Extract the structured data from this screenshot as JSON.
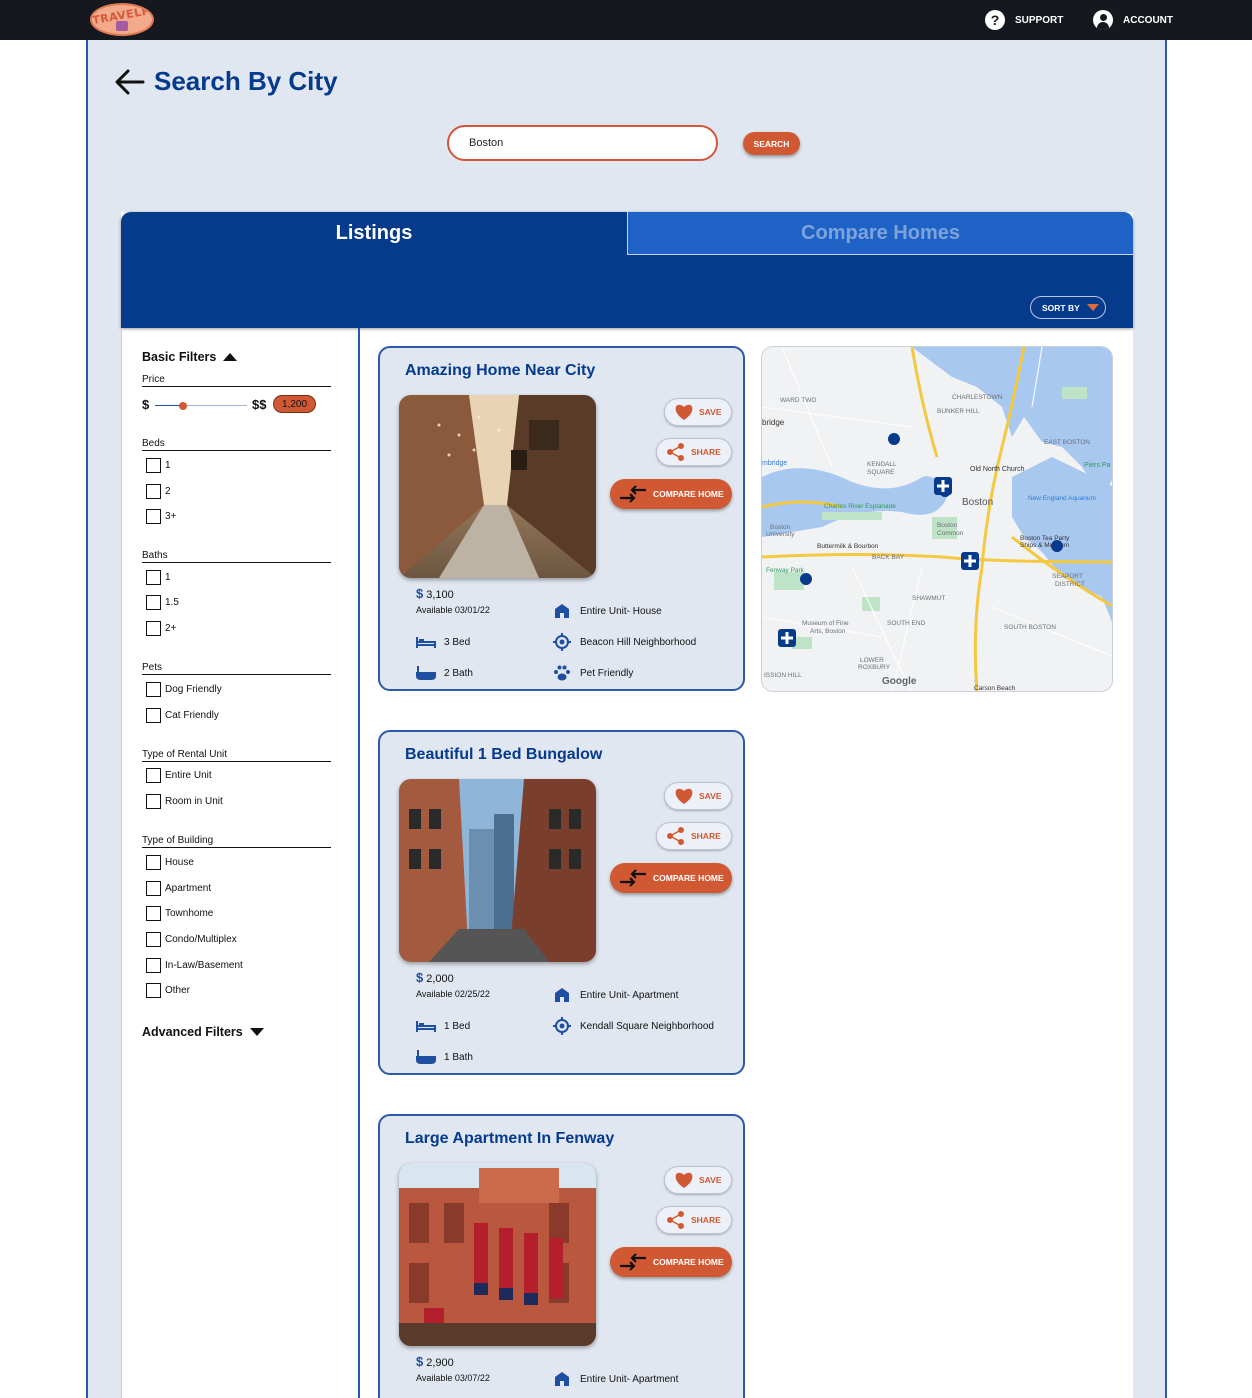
{
  "app": {
    "logo_text": "TRAVELPAD"
  },
  "topbar": {
    "support_label": "SUPPORT",
    "account_label": "ACCOUNT"
  },
  "page": {
    "title": "Search By City"
  },
  "search": {
    "value": "Boston",
    "button_label": "SEARCH"
  },
  "tabs": {
    "listings": "Listings",
    "compare": "Compare Homes",
    "sort_label": "SORT BY"
  },
  "colors": {
    "navy": "#063a8a",
    "accent": "#d05934",
    "panel_bg": "#e1e7f0",
    "tab_inactive": "#1e62c6"
  },
  "filters": {
    "basic_title": "Basic Filters",
    "advanced_title": "Advanced Filters",
    "price": {
      "label": "Price",
      "min_label": "$",
      "max_label": "$$",
      "value": "1,200",
      "slider_level": 0.3
    },
    "beds": {
      "label": "Beds",
      "options": [
        "1",
        "2",
        "3+"
      ]
    },
    "baths": {
      "label": "Baths",
      "options": [
        "1",
        "1.5",
        "2+"
      ]
    },
    "pets": {
      "label": "Pets",
      "options": [
        "Dog Friendly",
        "Cat Friendly"
      ]
    },
    "rental_type": {
      "label": "Type of Rental Unit",
      "options": [
        "Entire Unit",
        "Room in Unit"
      ]
    },
    "building_type": {
      "label": "Type of Building",
      "options": [
        "House",
        "Apartment",
        "Townhome",
        "Condo/Multiplex",
        "In-Law/Basement",
        "Other"
      ]
    }
  },
  "card_actions": {
    "save": "SAVE",
    "share": "SHARE",
    "compare": "COMPARE HOME"
  },
  "listings": [
    {
      "title": "Amazing Home Near City",
      "price": "3,100",
      "available": "Available 03/01/22",
      "unit": "Entire Unit- House",
      "beds": "3 Bed",
      "neighborhood": "Beacon Hill Neighborhood",
      "baths": "2 Bath",
      "pets": "Pet Friendly"
    },
    {
      "title": "Beautiful 1 Bed Bungalow",
      "price": "2,000",
      "available": "Available 02/25/22",
      "unit": "Entire Unit- Apartment",
      "beds": "1 Bed",
      "neighborhood": "Kendall Square Neighborhood",
      "baths": "1 Bath"
    },
    {
      "title": "Large Apartment In Fenway",
      "price": "2,900",
      "available": "Available 03/07/22",
      "unit": "Entire Unit- Apartment"
    }
  ],
  "map": {
    "labels": [
      "CHARLESTOWN",
      "BUNKER HILL",
      "WARD TWO",
      "EAST BOSTON",
      "Old North Church",
      "Piers Pa",
      "KENDALL SQUARE",
      "Boston",
      "New England Aquarium",
      "Charles River Esplanade",
      "Boston Common",
      "Boston University",
      "Buttermilk & Bourbon",
      "BACK BAY",
      "Boston Tea Party Ships & Museum",
      "Fenway Park",
      "SEAPORT DISTRICT",
      "SHAWMUT",
      "Museum of Fine Arts, Boston",
      "SOUTH END",
      "SOUTH BOSTON",
      "LOWER ROXBURY",
      "ISSION HILL",
      "Carson Beach",
      "Google",
      "bridge",
      "mbridge"
    ]
  }
}
